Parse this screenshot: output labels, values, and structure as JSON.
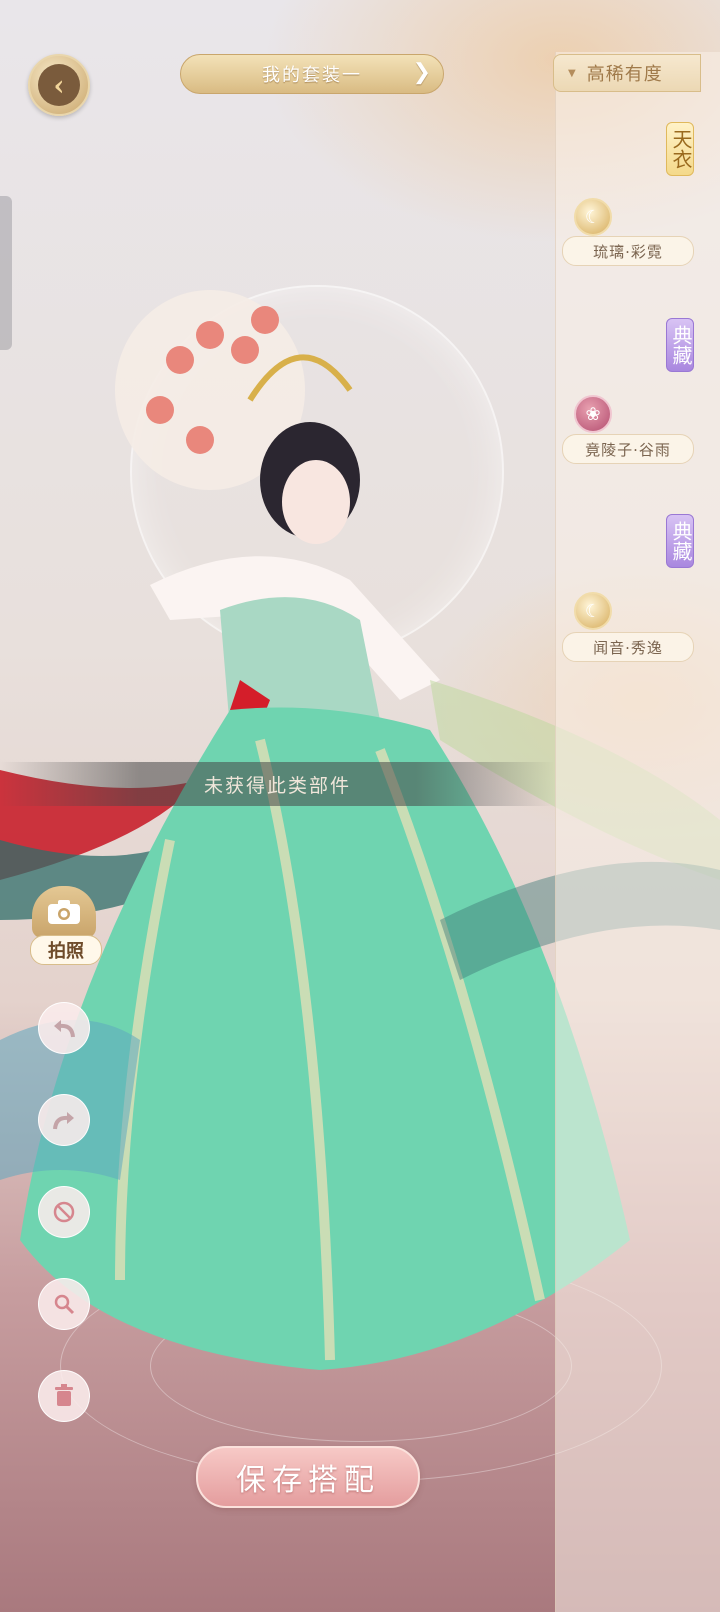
{
  "header": {
    "outfit_name": "我的套装一",
    "sort_label": "高稀有度"
  },
  "items": [
    {
      "tag": "天衣",
      "tag_style": "gold",
      "icon": "moon-icon",
      "name": "琉璃·彩霓"
    },
    {
      "tag": "典藏",
      "tag_style": "purple",
      "icon": "lotus-icon",
      "name": "竟陵子·谷雨"
    },
    {
      "tag": "典藏",
      "tag_style": "purple",
      "icon": "moon-icon",
      "name": "闻音·秀逸"
    }
  ],
  "toast": "未获得此类部件",
  "photo_label": "拍照",
  "tools": [
    "undo-icon",
    "redo-icon",
    "clear-icon",
    "zoom-icon",
    "trash-icon"
  ],
  "save_label": "保存搭配",
  "colors": {
    "accent_gold": "#d9bb83",
    "save_pink": "#e49d9e",
    "rare_purple": "#a987df"
  }
}
